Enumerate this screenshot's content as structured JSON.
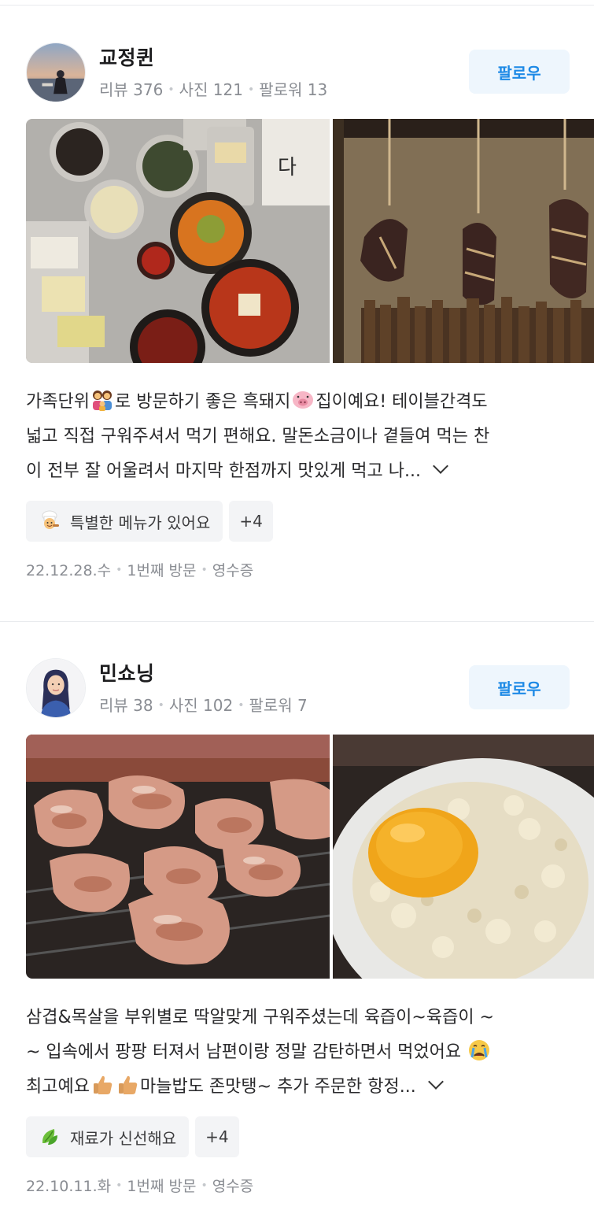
{
  "reviews": [
    {
      "user": {
        "name": "교정퀸",
        "reviews": "리뷰 376",
        "photos": "사진 121",
        "followers": "팔로워 13"
      },
      "follow_label": "팔로우",
      "text": {
        "line1_a": "가족단위",
        "line1_b": "로 방문하기 좋은 흑돼지",
        "line1_c": "집이예요! 테이블간격도",
        "line2": "넓고 직접 구워주셔서 먹기 편해요. 말돈소금이나 곁들여 먹는 찬",
        "line3": "이 전부 잘 어울려서 마지막 한점까지 맛있게 먹고 나..."
      },
      "tag": {
        "label": "특별한 메뉴가 있어요",
        "icon": "chef-icon"
      },
      "more_tags": "+4",
      "footer": {
        "date": "22.12.28.수",
        "visit": "1번째 방문",
        "proof": "영수증"
      }
    },
    {
      "user": {
        "name": "민쇼닝",
        "reviews": "리뷰 38",
        "photos": "사진 102",
        "followers": "팔로워 7"
      },
      "follow_label": "팔로우",
      "text": {
        "line1": "삼겹&목살을 부위별로 딱알맞게 구워주셨는데 육즙이~육즙이 ~",
        "line2_a": "~ 입속에서 팡팡 터져서 남편이랑 정말 감탄하면서 먹었어요",
        "line3_a": "최고예요",
        "line3_b": "마늘밥도 존맛탱~ 추가 주문한 항정..."
      },
      "tag": {
        "label": "재료가 신선해요",
        "icon": "leaf-icon"
      },
      "more_tags": "+4",
      "footer": {
        "date": "22.10.11.화",
        "visit": "1번째 방문",
        "proof": "영수증"
      }
    }
  ]
}
